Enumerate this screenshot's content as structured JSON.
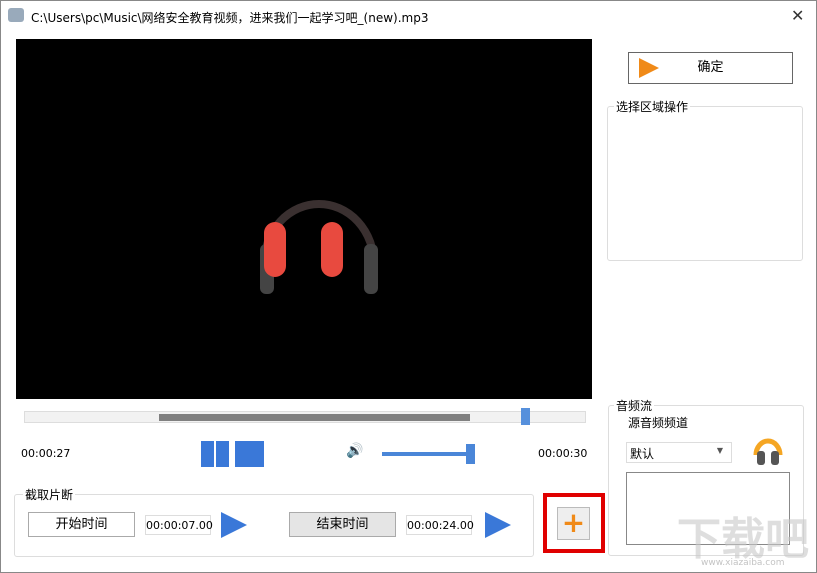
{
  "window": {
    "title": "C:\\Users\\pc\\Music\\网络安全教育视频，进来我们一起学习吧_(new).mp3",
    "close": "✕"
  },
  "player": {
    "current_time": "00:00:27",
    "total_time": "00:00:30",
    "progress": 0.9,
    "selection_start": 0.23,
    "selection_end": 0.8,
    "volume": 0.95
  },
  "right": {
    "confirm_label": "确定",
    "selection_group": "选择区域操作",
    "audio_group": "音频流",
    "source_channel_label": "源音频频道",
    "channel_value": "默认"
  },
  "clip": {
    "group_label": "截取片断",
    "start_label": "开始时间",
    "start_value": "00:00:07.00",
    "end_label": "结束时间",
    "end_value": "00:00:24.00"
  },
  "watermark": {
    "text": "下载吧",
    "url": "www.xiazaiba.com"
  }
}
